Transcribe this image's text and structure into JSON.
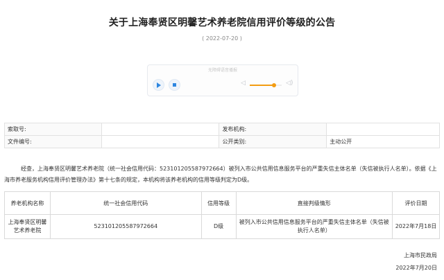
{
  "article": {
    "title": "关于上海奉贤区明馨艺术养老院信用评价等级的公告",
    "date": "( 2022-07-20 )"
  },
  "player": {
    "title": "无障碍语音播报",
    "play_icon": "play-icon",
    "stop_icon": "stop-icon",
    "volume_low_icon": "volume-low-icon",
    "volume_high_icon": "volume-high-icon",
    "volume_level": 0.75,
    "accent": "#f39c12"
  },
  "info": {
    "rows": [
      [
        {
          "text": "索取号:",
          "label": true
        },
        {
          "text": ""
        },
        {
          "text": "发布机构:",
          "label": true
        },
        {
          "text": ""
        }
      ],
      [
        {
          "text": "文件编号:",
          "label": true
        },
        {
          "text": ""
        },
        {
          "text": "公开类别:",
          "label": true
        },
        {
          "text": "主动公开"
        }
      ]
    ]
  },
  "body": {
    "para1": "经查，上海奉贤区明馨艺术养老院（统一社会信用代码：523101205587972664）被列入市公共信用信息服务平台的严重失信主体名单（失信被执行人名单）。依据《上海市养老服务机构信用评价管理办法》第十七条的规定，本机构将该养老机构的信用等级判定为D级。"
  },
  "table": {
    "headers": [
      "养老机构名称",
      "统一社会信用代码",
      "信用等级",
      "直接判级情形",
      "评价日期"
    ],
    "rows": [
      [
        "上海奉贤区明馨艺术养老院",
        "523101205587972664",
        "D级",
        "被列入市公共信用信息服务平台的严重失信主体名单（失信被执行人名单）",
        "2022年7月18日"
      ]
    ]
  },
  "signature": {
    "agency": "上海市民政局",
    "date": "2022年7月20日"
  }
}
